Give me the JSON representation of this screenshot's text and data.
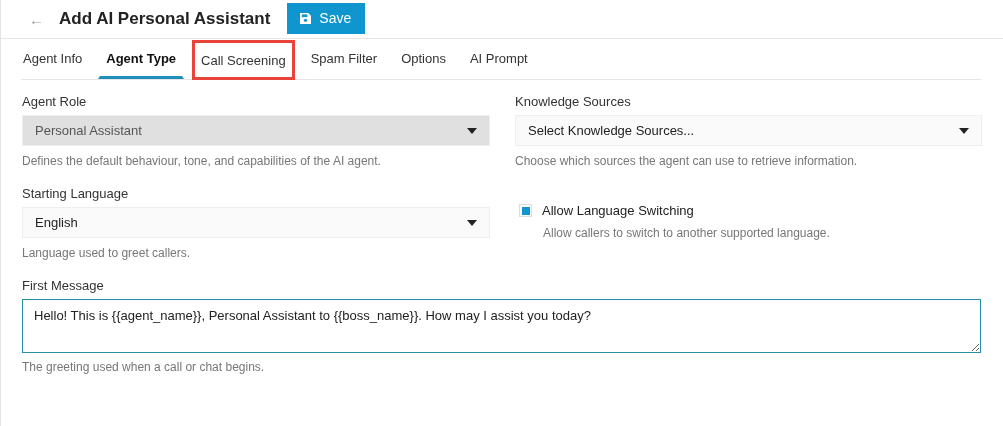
{
  "header": {
    "back": "←",
    "title": "Add AI Personal Assistant",
    "save_button": "Save"
  },
  "tabs": [
    {
      "label": "Agent Info",
      "selected": false,
      "highlighted": false
    },
    {
      "label": "Agent Type",
      "selected": true,
      "highlighted": false
    },
    {
      "label": "Call Screening",
      "selected": false,
      "highlighted": true
    },
    {
      "label": "Spam Filter",
      "selected": false,
      "highlighted": false
    },
    {
      "label": "Options",
      "selected": false,
      "highlighted": false
    },
    {
      "label": "AI Prompt",
      "selected": false,
      "highlighted": false
    }
  ],
  "agent_role": {
    "label": "Agent Role",
    "value": "Personal Assistant",
    "disabled": true,
    "help": "Defines the default behaviour, tone, and capabilities of the AI agent."
  },
  "knowledge_sources": {
    "label": "Knowledge Sources",
    "placeholder": "Select Knowledge Sources...",
    "help": "Choose which sources the agent can use to retrieve information."
  },
  "starting_language": {
    "label": "Starting Language",
    "value": "English",
    "disabled": false,
    "help": "Language used to greet callers."
  },
  "allow_language_switching": {
    "label": "Allow Language Switching",
    "checked": true,
    "help": "Allow callers to switch to another supported language."
  },
  "first_message": {
    "label": "First Message",
    "value": "Hello! This is {{agent_name}}, Personal Assistant to {{boss_name}}. How may I assist you today?",
    "help": "The greeting used when a call or chat begins."
  }
}
